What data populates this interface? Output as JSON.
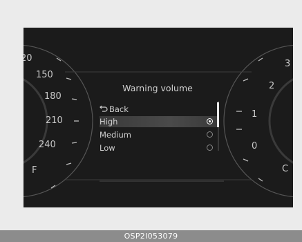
{
  "cluster": {
    "left_gauge": {
      "labels": [
        "20",
        "150",
        "180",
        "210",
        "240",
        "F"
      ]
    },
    "right_gauge": {
      "labels": [
        "3",
        "2",
        "1",
        "0",
        "C"
      ]
    }
  },
  "menu": {
    "title": "Warning volume",
    "back_label": "Back",
    "items": [
      {
        "label": "High",
        "selected": true
      },
      {
        "label": "Medium",
        "selected": false
      },
      {
        "label": "Low",
        "selected": false
      }
    ]
  },
  "caption": "OSP2I053079"
}
